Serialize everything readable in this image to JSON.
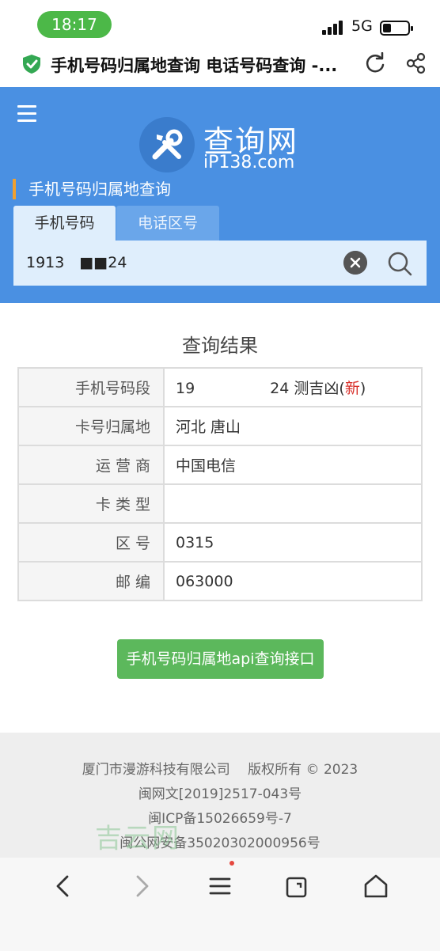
{
  "status_bar": {
    "time": "18:17",
    "network": "5G"
  },
  "browser": {
    "page_title": "手机号码归属地查询 电话号码查询 -...",
    "secure_icon": "shield-check-icon",
    "accent": "#34a853"
  },
  "header": {
    "logo_title": "查询网",
    "logo_subtitle": "iP138.com",
    "section_title": "手机号码归属地查询",
    "tabs": [
      {
        "label": "手机号码",
        "active": true
      },
      {
        "label": "电话区号",
        "active": false
      }
    ],
    "search_value": "1913  ■■24",
    "bg_color": "#4a90e2"
  },
  "result": {
    "title": "查询结果",
    "rows": [
      {
        "label": "手机号码段",
        "value": "19     24 测吉凶",
        "paren_open": "(",
        "new_tag": "新",
        "paren_close": ")"
      },
      {
        "label": "卡号归属地",
        "value": "河北 唐山"
      },
      {
        "label": "运 营 商",
        "value": "中国电信"
      },
      {
        "label": "卡 类 型",
        "value": ""
      },
      {
        "label": "区 号",
        "value": "0315"
      },
      {
        "label": "邮 编",
        "value": "063000"
      }
    ]
  },
  "api_button": {
    "label": "手机号码归属地api查询接口",
    "color": "#5cb85c"
  },
  "footer": {
    "lines": [
      "厦门市漫游科技有限公司　 版权所有 © 2023",
      "闽网文[2019]2517-043号",
      "闽ICP备15026659号-7",
      "闽公网安备35020302000956号"
    ],
    "watermark": "吉云网"
  },
  "bottom_nav": {
    "items": [
      "back-icon",
      "forward-icon",
      "menu-icon",
      "tabs-icon",
      "home-icon"
    ]
  }
}
